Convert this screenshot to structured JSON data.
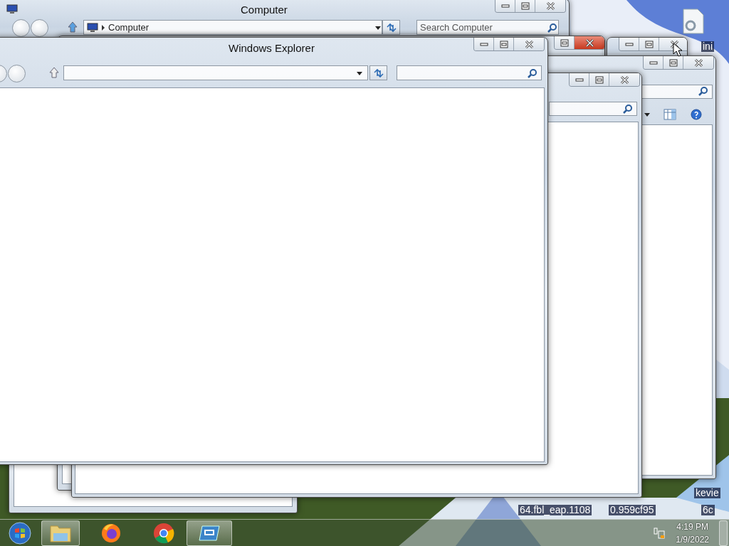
{
  "desktop": {
    "labels": [
      {
        "text": "ini"
      },
      {
        "text": "kevie"
      },
      {
        "text": "64.fbl_eap.1108"
      },
      {
        "text": "0.959cf95"
      },
      {
        "text": "6c"
      }
    ]
  },
  "windows": [
    {
      "kind": "frame"
    },
    {
      "kind": "explorer",
      "title": "Computer",
      "address": "Computer",
      "search": {
        "placeholder": "Search Computer"
      },
      "close_highlighted": false
    },
    {
      "kind": "frame",
      "close_highlighted": true
    },
    {
      "kind": "frame",
      "close_highlighted": false
    },
    {
      "kind": "toolbar",
      "close_highlighted": false
    },
    {
      "kind": "search",
      "close_highlighted": false
    },
    {
      "kind": "explorer",
      "title": "Windows Explorer",
      "close_highlighted": false
    }
  ],
  "taskbar": {
    "items": [
      {
        "kind": "start",
        "active": false
      },
      {
        "kind": "folder",
        "active": true
      },
      {
        "kind": "firefox",
        "active": false
      },
      {
        "kind": "chrome",
        "active": false
      },
      {
        "kind": "app",
        "active": true
      }
    ],
    "clock": {
      "time": "4:19 PM",
      "date": "1/9/2022"
    }
  }
}
